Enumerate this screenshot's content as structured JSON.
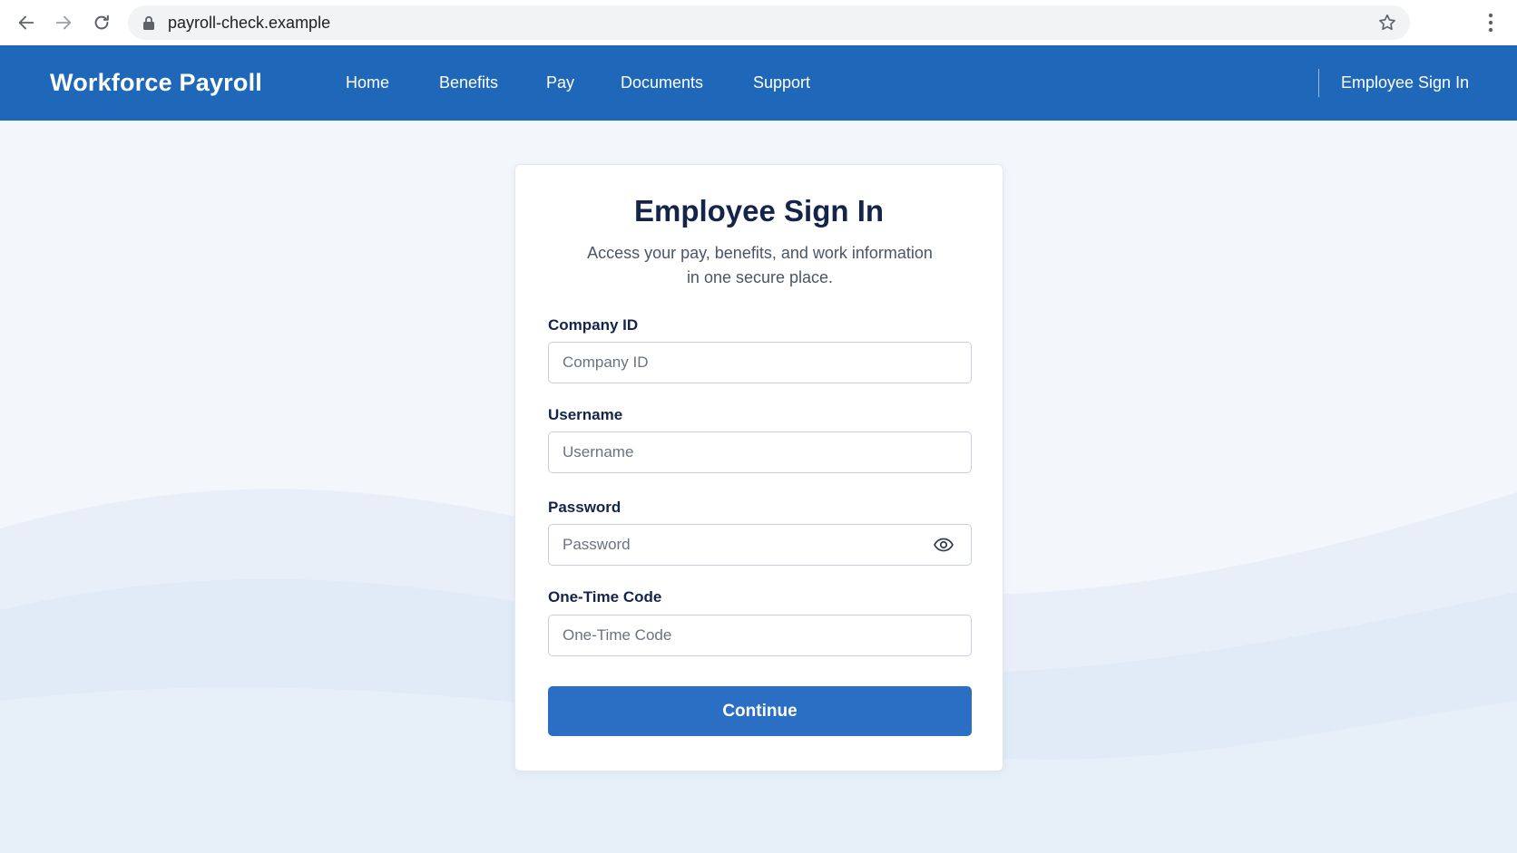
{
  "browser": {
    "url": "payroll-check.example",
    "icons": [
      "back-arrow-icon",
      "forward-arrow-icon",
      "reload-icon",
      "lock-icon",
      "star-icon",
      "menu-icon"
    ]
  },
  "header": {
    "brand": "Workforce Payroll",
    "nav": [
      "Home",
      "Benefits",
      "Pay",
      "Documents",
      "Support"
    ],
    "signin_link": "Employee Sign In",
    "background_color": "#1f68b9"
  },
  "card": {
    "title": "Employee Sign In",
    "subtitle_line1": "Access your pay, benefits, and work information",
    "subtitle_line2": "in one secure place.",
    "fields": {
      "company_id": {
        "label": "Company ID",
        "placeholder": "Company ID",
        "value": ""
      },
      "username": {
        "label": "Username",
        "placeholder": "Username",
        "value": ""
      },
      "password": {
        "label": "Password",
        "placeholder": "Password",
        "value": "",
        "toggle_icon": "eye-icon"
      },
      "otp": {
        "label": "One-Time Code",
        "placeholder": "One-Time Code",
        "value": ""
      }
    },
    "continue_label": "Continue",
    "button_color": "#2a6fc4"
  }
}
